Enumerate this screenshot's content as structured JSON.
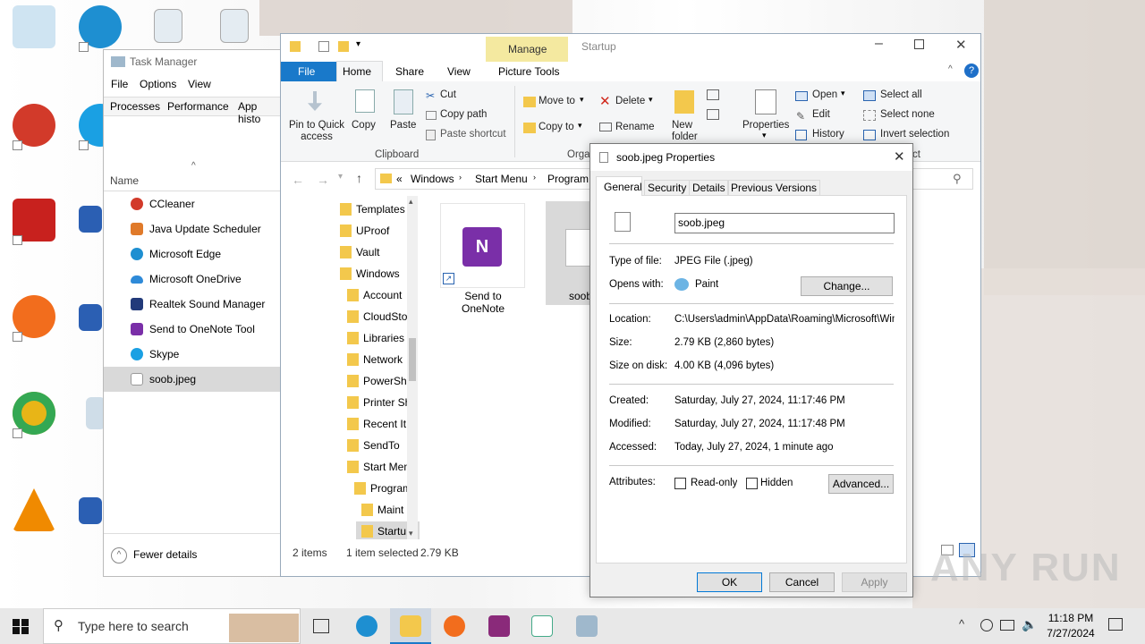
{
  "desktop": {
    "icons": [
      "recycle-bin",
      "edge",
      "ccleaner",
      "skype",
      "acrobat",
      "word",
      "firefox",
      "word",
      "chrome",
      "image",
      "vlc",
      "word"
    ]
  },
  "task_manager": {
    "title": "Task Manager",
    "menu": [
      "File",
      "Options",
      "View"
    ],
    "tabs": [
      "Processes",
      "Performance",
      "App histo"
    ],
    "column": "Name",
    "rows": [
      "CCleaner",
      "Java Update Scheduler",
      "Microsoft Edge",
      "Microsoft OneDrive",
      "Realtek Sound Manager",
      "Send to OneNote Tool",
      "Skype",
      "soob.jpeg"
    ],
    "footer": "Fewer details"
  },
  "explorer": {
    "context_tab": "Manage",
    "window_title": "Startup",
    "tabs": [
      "File",
      "Home",
      "Share",
      "View",
      "Picture Tools"
    ],
    "ribbon": {
      "pin": "Pin to Quick access",
      "copy": "Copy",
      "paste": "Paste",
      "cut": "Cut",
      "copy_path": "Copy path",
      "paste_shortcut": "Paste shortcut",
      "clipboard": "Clipboard",
      "move_to": "Move to",
      "copy_to": "Copy to",
      "organize": "Orga",
      "delete": "Delete",
      "rename": "Rename",
      "new_folder": "New folder",
      "properties": "Properties",
      "open": "Open",
      "edit": "Edit",
      "history": "History",
      "select_all": "Select all",
      "select_none": "Select none",
      "invert": "Invert selection",
      "select_group": "ct"
    },
    "breadcrumb": [
      "«",
      "Windows",
      "Start Menu",
      "Program"
    ],
    "tree": [
      "Templates",
      "UProof",
      "Vault",
      "Windows",
      "Account",
      "CloudSto",
      "Libraries",
      "Network",
      "PowerSh",
      "Printer Sh",
      "Recent It",
      "SendTo",
      "Start Men",
      "Program",
      "Maint",
      "Startu"
    ],
    "files": [
      "Send to OneNote",
      "soob"
    ],
    "status": {
      "items": "2 items",
      "selected": "1 item selected",
      "size": "2.79 KB"
    }
  },
  "dialog": {
    "title": "soob.jpeg Properties",
    "tabs": [
      "General",
      "Security",
      "Details",
      "Previous Versions"
    ],
    "filename": "soob.jpeg",
    "type_label": "Type of file:",
    "type_value": "JPEG File (.jpeg)",
    "opens_label": "Opens with:",
    "opens_value": "Paint",
    "change": "Change...",
    "location_label": "Location:",
    "location_value": "C:\\Users\\admin\\AppData\\Roaming\\Microsoft\\Wind",
    "size_label": "Size:",
    "size_value": "2.79 KB (2,860 bytes)",
    "disk_label": "Size on disk:",
    "disk_value": "4.00 KB (4,096 bytes)",
    "created_label": "Created:",
    "created_value": "Saturday, July 27, 2024, 11:17:46 PM",
    "modified_label": "Modified:",
    "modified_value": "Saturday, July 27, 2024, 11:17:48 PM",
    "accessed_label": "Accessed:",
    "accessed_value": "Today, July 27, 2024, 1 minute ago",
    "attributes_label": "Attributes:",
    "readonly": "Read-only",
    "hidden": "Hidden",
    "advanced": "Advanced...",
    "ok": "OK",
    "cancel": "Cancel",
    "apply": "Apply"
  },
  "taskbar": {
    "search_placeholder": "Type here to search",
    "time": "11:18 PM",
    "date": "7/27/2024"
  },
  "watermark": "ANY RUN"
}
